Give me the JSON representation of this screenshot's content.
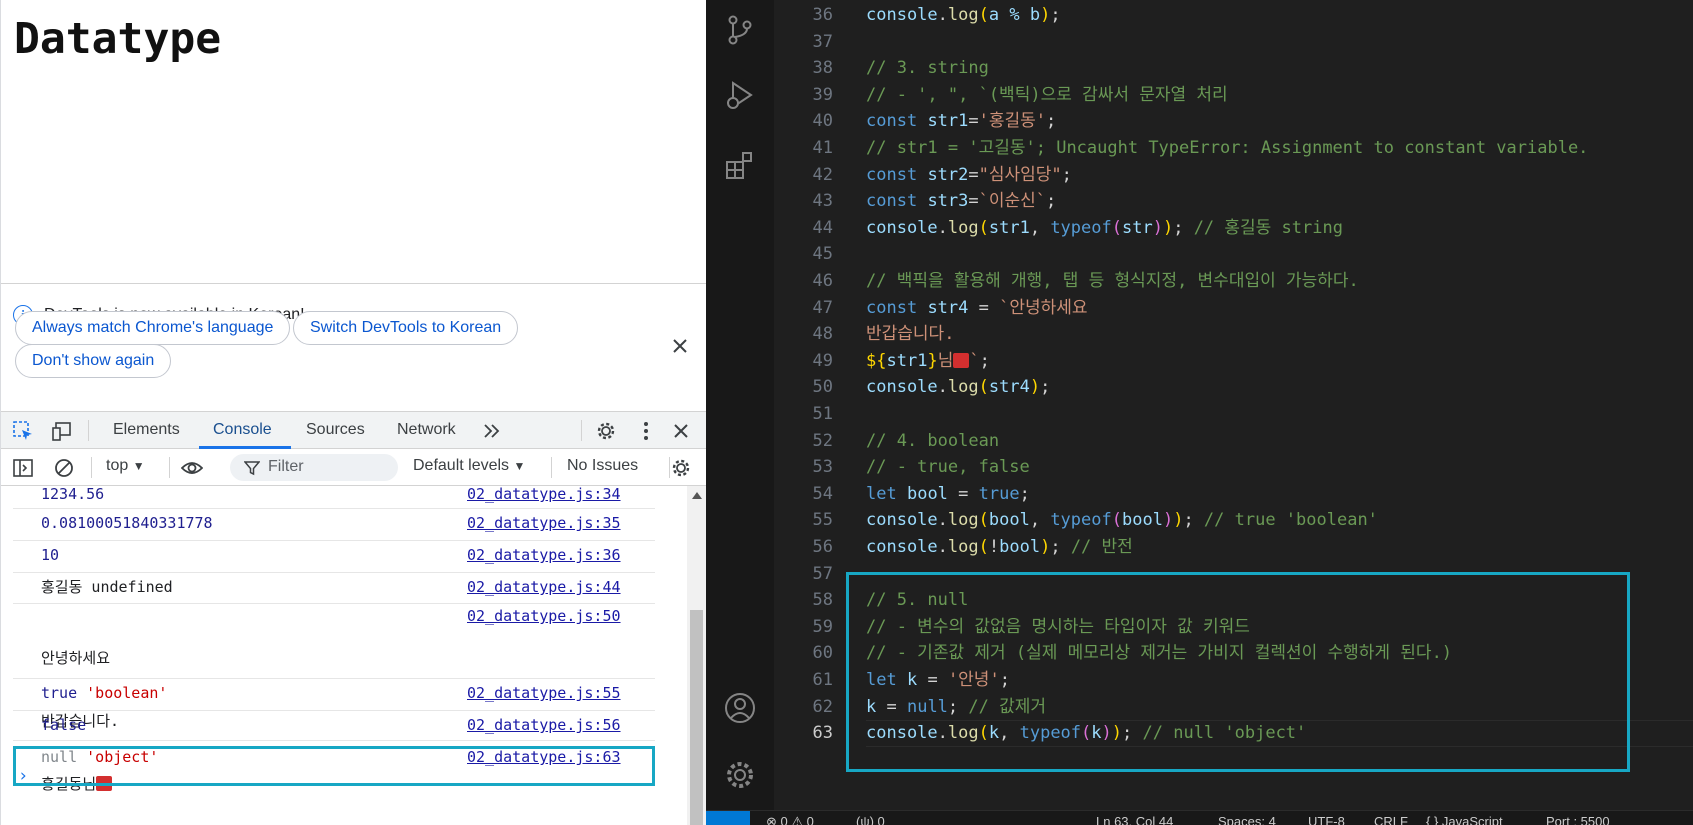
{
  "browser": {
    "page_heading": "Datatype"
  },
  "devtools": {
    "infobar": {
      "message": "DevTools is now available in Korean!",
      "buttons": [
        "Always match Chrome's language",
        "Switch DevTools to Korean",
        "Don't show again"
      ]
    },
    "tabs": [
      "Elements",
      "Console",
      "Sources",
      "Network"
    ],
    "active_tab": "Console",
    "filterbar": {
      "context": "top",
      "filter_placeholder": "Filter",
      "levels": "Default levels",
      "issues": "No Issues"
    },
    "console_rows": [
      {
        "msg": "1234.56",
        "src": "02_datatype.js:34"
      },
      {
        "msg": "0.08100051840331778",
        "src": "02_datatype.js:35"
      },
      {
        "msg": "10",
        "src": "02_datatype.js:36"
      },
      {
        "msg": "홍길동 undefined",
        "src": "02_datatype.js:44"
      },
      {
        "msg_lines": [
          "안녕하세요",
          "반갑습니다.",
          "홍길동님"
        ],
        "src": "02_datatype.js:50"
      },
      {
        "msg_a": "true",
        "msg_b": "'boolean'",
        "src": "02_datatype.js:55"
      },
      {
        "msg": "false",
        "src": "02_datatype.js:56"
      },
      {
        "msg_a": "null",
        "msg_b": "'object'",
        "src": "02_datatype.js:63"
      }
    ],
    "prompt": "›"
  },
  "editor": {
    "current_line": "63",
    "lines": [
      {
        "n": "36"
      },
      {
        "n": "37"
      },
      {
        "n": "38"
      },
      {
        "n": "39"
      },
      {
        "n": "40"
      },
      {
        "n": "41"
      },
      {
        "n": "42"
      },
      {
        "n": "43"
      },
      {
        "n": "44"
      },
      {
        "n": "45"
      },
      {
        "n": "46"
      },
      {
        "n": "47"
      },
      {
        "n": "48"
      },
      {
        "n": "49"
      },
      {
        "n": "50"
      },
      {
        "n": "51"
      },
      {
        "n": "52"
      },
      {
        "n": "53"
      },
      {
        "n": "54"
      },
      {
        "n": "55"
      },
      {
        "n": "56"
      },
      {
        "n": "57"
      },
      {
        "n": "58"
      },
      {
        "n": "59"
      },
      {
        "n": "60"
      },
      {
        "n": "61"
      },
      {
        "n": "62"
      },
      {
        "n": "63"
      }
    ],
    "tokens": {
      "l36": [
        "console",
        ".",
        "log",
        "(",
        "a % b",
        ")",
        ";"
      ],
      "l38": "// 3. string",
      "l39": "// - ', \", `(백틱)으로 감싸서 문자열 처리",
      "l40": [
        "const",
        "str1",
        "=",
        "'홍길동'",
        ";"
      ],
      "l41": "// str1 = '고길동'; Uncaught TypeError: Assignment to constant variable.",
      "l42": [
        "const",
        "str2",
        "=",
        "\"심사임당\"",
        ";"
      ],
      "l43": [
        "const",
        "str3",
        "=",
        "`이순신`",
        ";"
      ],
      "l44": [
        "console",
        ".",
        "log",
        "(",
        "str1",
        ", ",
        "typeof",
        "(",
        "str",
        ")",
        ")",
        ";",
        " // 홍길동 string"
      ],
      "l46": "// 백픽을 활용해 개행, 탭 등 형식지정, 변수대입이 가능하다.",
      "l47": [
        "const",
        "str4",
        " = ",
        "`안녕하세요"
      ],
      "l48": "반갑습니다.",
      "l49": [
        "${",
        "str1",
        "}",
        "님",
        "`",
        ";"
      ],
      "l50": [
        "console",
        ".",
        "log",
        "(",
        "str4",
        ")",
        ";"
      ],
      "l52": "// 4. boolean",
      "l53": "// - true, false",
      "l54": [
        "let",
        "bool",
        " = ",
        "true",
        ";"
      ],
      "l55": [
        "console",
        ".",
        "log",
        "(",
        "bool",
        ", ",
        "typeof",
        "(",
        "bool",
        ")",
        ")",
        ";",
        " // true 'boolean'"
      ],
      "l56": [
        "console",
        ".",
        "log",
        "(",
        "!",
        "bool",
        ")",
        ";",
        " // 반전"
      ],
      "l58": "// 5. null",
      "l59": "// - 변수의 값없음 명시하는 타입이자 값 키워드",
      "l60": "// - 기존값 제거 (실제 메모리상 제거는 가비지 컬렉션이 수행하게 된다.)",
      "l61": [
        "let",
        "k",
        " = ",
        "'안녕'",
        ";"
      ],
      "l62": [
        "k",
        " = ",
        "null",
        ";",
        " // 값제거"
      ],
      "l63": [
        "console",
        ".",
        "log",
        "(",
        "k",
        ", ",
        "typeof",
        "(",
        "k",
        ")",
        ")",
        ";",
        " // null 'object'"
      ]
    }
  },
  "statusbar": {
    "problems": "⊗ 0 ⚠ 0",
    "ports": "(ψ) 0",
    "position": "Ln 63, Col 44",
    "spaces": "Spaces: 4",
    "encoding": "UTF-8",
    "eol": "CRLF",
    "language": "{ } JavaScript",
    "port": "Port : 5500"
  },
  "colors": {
    "highlight_box": "#17a7c4",
    "vscode_bg": "#1f1f1f",
    "link_blue": "#1a1aa6"
  }
}
